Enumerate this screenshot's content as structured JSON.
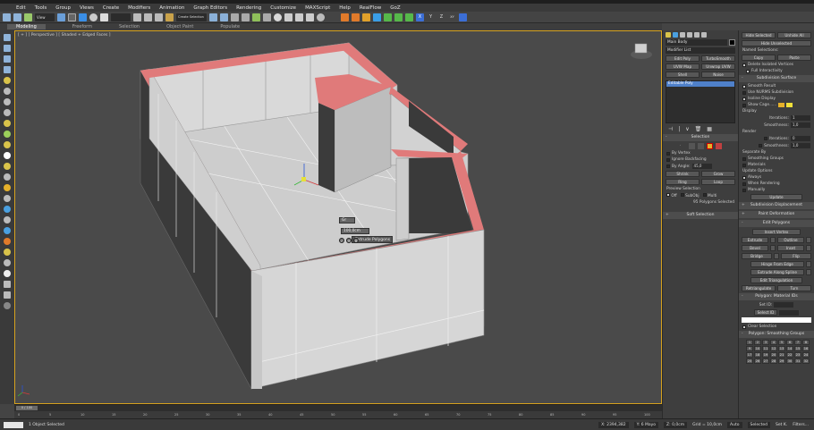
{
  "menu": [
    "Edit",
    "Tools",
    "Group",
    "Views",
    "Create",
    "Modifiers",
    "Animation",
    "Graph Editors",
    "Rendering",
    "Customize",
    "MAXScript",
    "Help",
    "RealFlow",
    "GoZ"
  ],
  "toolbar": {
    "view_dropdown": "View",
    "selection_set": "Create Selection Se",
    "axis_labels": [
      "X",
      "Y",
      "Z",
      "XY"
    ]
  },
  "ribbon_tabs": [
    {
      "label": "Modeling",
      "active": true
    },
    {
      "label": "Freeform",
      "active": false
    },
    {
      "label": "Selection",
      "active": false
    },
    {
      "label": "Object Paint",
      "active": false
    },
    {
      "label": "Populate",
      "active": false
    }
  ],
  "viewport": {
    "label": "[ + ] [ Perspective ] [ Shaded + Edged Faces ]",
    "caddy": {
      "title": "Extrude Polygons",
      "height_value": "100,0cm",
      "type_value": "Gr"
    }
  },
  "timeline": {
    "slider_label": "0 / 100",
    "ticks": [
      "0",
      "5",
      "10",
      "15",
      "20",
      "25",
      "30",
      "35",
      "40",
      "45",
      "50",
      "55",
      "60",
      "65",
      "70",
      "75",
      "80",
      "85",
      "90",
      "95",
      "100"
    ]
  },
  "status": {
    "message": "1 Object Selected",
    "x": "X: 2394,382",
    "y": "Y: 6 Mayo",
    "z": "Z: 0,0cm",
    "grid": "Grid = 10,0cm",
    "auto": "Auto",
    "selected": "Selected",
    "set_key": "Set K.",
    "filters": "Filters..."
  },
  "command_panel": {
    "object_name": "Main Body",
    "modifier_list": "Modifier List",
    "buttons": [
      [
        "Edit Poly",
        "TurboSmooth"
      ],
      [
        "UVW Map",
        "Unwrap UVW"
      ],
      [
        "Shell",
        "Noise"
      ]
    ],
    "stack_item": "Editable Poly",
    "selection_title": "Selection",
    "by_vertex": "By Vertex",
    "ignore_backfacing": "Ignore Backfacing",
    "by_angle": "By Angle:",
    "by_angle_value": "45,0",
    "shrink": "Shrink",
    "grow": "Grow",
    "ring": "Ring",
    "loop": "Loop",
    "preview_selection": "Preview Selection",
    "preview_off": "Off",
    "preview_subobj": "SubObj",
    "preview_multi": "Multi",
    "selected_count": "95 Polygons Selected",
    "soft_selection": "Soft Selection"
  },
  "right_panel": {
    "hide_selected": "Hide Selected",
    "unhide_all": "Unhide All",
    "hide_unselected": "Hide Unselected",
    "named_selections": "Named Selections:",
    "copy": "Copy",
    "paste": "Paste",
    "delete_isolated": "Delete Isolated Vertices",
    "full_interactivity": "Full Interactivity",
    "subdivision_surface": "Subdivision Surface",
    "smooth_result": "Smooth Result",
    "use_nurms": "Use NURMS Subdivision",
    "isoline_display": "Isoline Display",
    "show_cage": "Show Cage......",
    "display": "Display",
    "iterations": "Iterations:",
    "iterations_value": "1",
    "smoothness": "Smoothness:",
    "smoothness_value": "1,0",
    "render": "Render",
    "render_iterations_value": "0",
    "render_smoothness_value": "1,0",
    "separate_by": "Separate By",
    "smoothing_groups": "Smoothing Groups",
    "materials": "Materials",
    "update_options": "Update Options",
    "always": "Always",
    "when_rendering": "When Rendering",
    "manually": "Manually",
    "update": "Update",
    "subdivision_displacement": "Subdivision Displacement",
    "paint_deformation": "Paint Deformation",
    "edit_polygons": "Edit Polygons",
    "insert_vertex": "Insert Vertex",
    "extrude": "Extrude",
    "outline": "Outline",
    "bevel": "Bevel",
    "inset": "Inset",
    "bridge": "Bridge",
    "flip": "Flip",
    "hinge_from_edge": "Hinge From Edge",
    "extrude_along_spline": "Extrude Along Spline",
    "edit_triangulation": "Edit Triangulation",
    "retriangulate": "Retriangulate",
    "turn": "Turn",
    "polygon_material_ids": "Polygon: Material IDs",
    "set_id": "Set ID:",
    "select_id": "Select ID",
    "clear_selection": "Clear Selection",
    "polygon_smoothing_groups": "Polygon: Smoothing Groups",
    "sg_numbers": [
      "1",
      "2",
      "3",
      "4",
      "5",
      "6",
      "7",
      "8",
      "9",
      "10",
      "11",
      "12",
      "13",
      "14",
      "15",
      "16",
      "17",
      "18",
      "19",
      "20",
      "21",
      "22",
      "23",
      "24",
      "25",
      "26",
      "27",
      "28",
      "29",
      "30",
      "31",
      "32"
    ]
  },
  "colors": {
    "accent": "#d6a21e",
    "selected_face": "#e07a7a",
    "wall": "#d8d8d8",
    "floor": "#cfcfcf"
  }
}
